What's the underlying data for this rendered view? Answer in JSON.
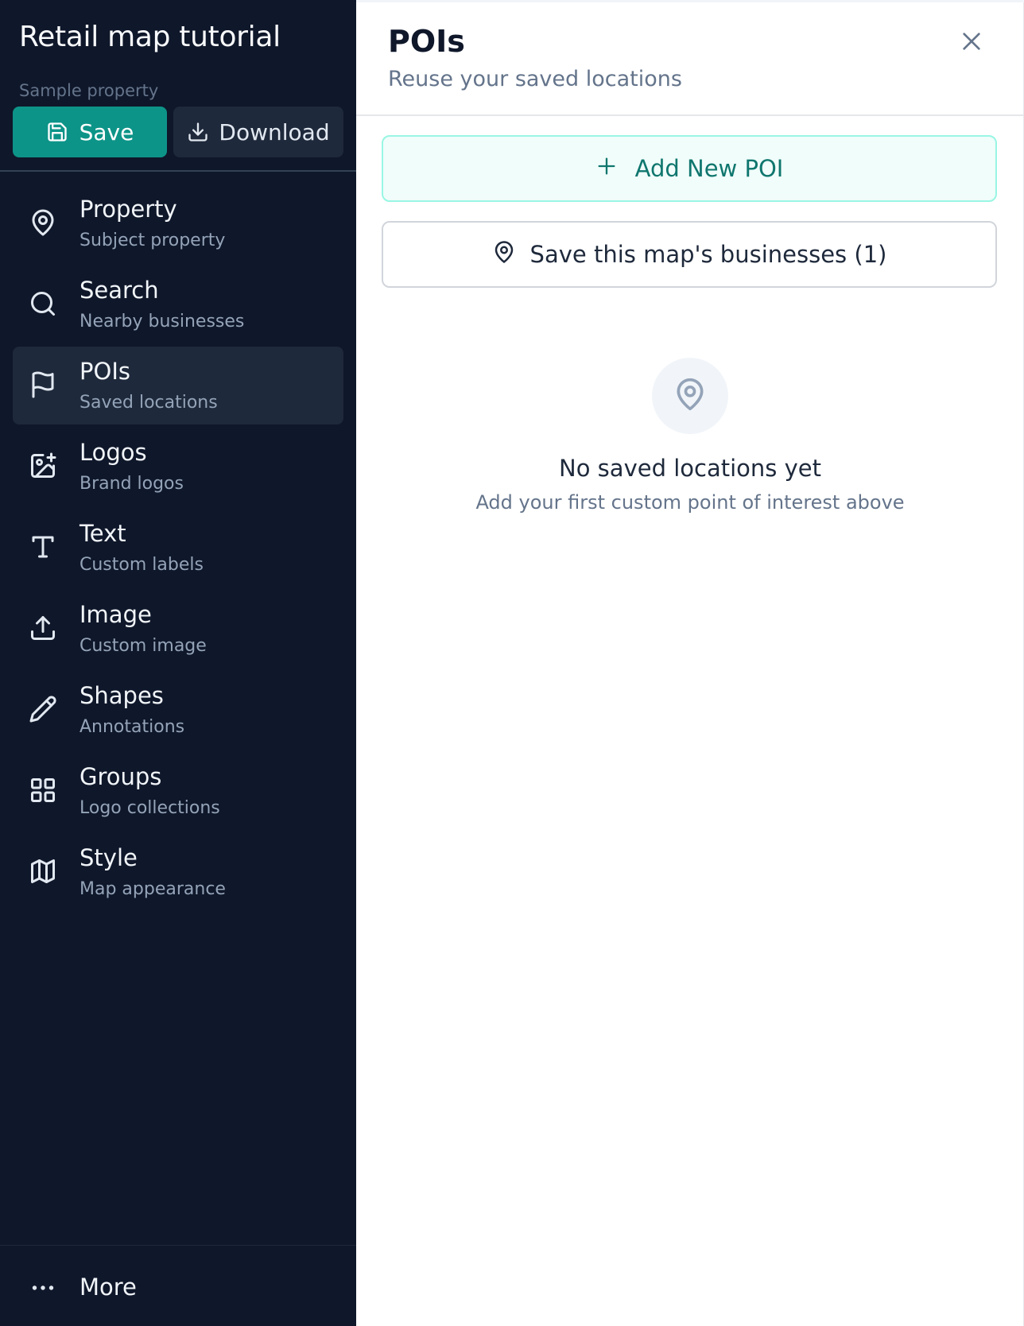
{
  "sidebar": {
    "title": "Retail map tutorial",
    "subtitle": "Sample property",
    "save_label": "Save",
    "download_label": "Download",
    "items": [
      {
        "label": "Property",
        "sub": "Subject property",
        "icon": "map-pin-icon"
      },
      {
        "label": "Search",
        "sub": "Nearby businesses",
        "icon": "search-icon"
      },
      {
        "label": "POIs",
        "sub": "Saved locations",
        "icon": "flag-icon",
        "active": true
      },
      {
        "label": "Logos",
        "sub": "Brand logos",
        "icon": "image-plus-icon"
      },
      {
        "label": "Text",
        "sub": "Custom labels",
        "icon": "text-icon"
      },
      {
        "label": "Image",
        "sub": "Custom image",
        "icon": "upload-icon"
      },
      {
        "label": "Shapes",
        "sub": "Annotations",
        "icon": "pencil-icon"
      },
      {
        "label": "Groups",
        "sub": "Logo collections",
        "icon": "grid-icon"
      },
      {
        "label": "Style",
        "sub": "Map appearance",
        "icon": "map-icon"
      }
    ],
    "more_label": "More"
  },
  "panel": {
    "title": "POIs",
    "subtitle": "Reuse your saved locations",
    "add_button_label": "Add New POI",
    "save_businesses_label": "Save this map's businesses (1)",
    "empty_title": "No saved locations yet",
    "empty_subtitle": "Add your first custom point of interest above"
  },
  "colors": {
    "sidebar_bg": "#0f172a",
    "accent": "#0d9488",
    "active_item_bg": "#1e293b"
  }
}
